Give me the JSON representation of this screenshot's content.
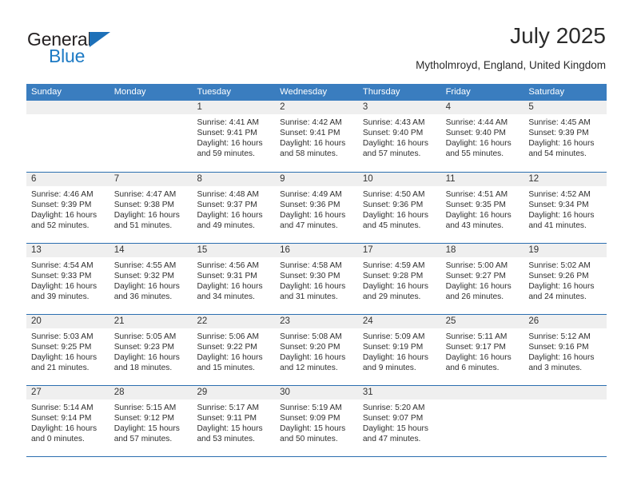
{
  "brand": {
    "name_part1": "General",
    "name_part2": "Blue",
    "accent_color": "#1d7ac4",
    "header_color": "#3a7dbf"
  },
  "header": {
    "title": "July 2025",
    "subtitle": "Mytholmroyd, England, United Kingdom"
  },
  "weekdays": [
    "Sunday",
    "Monday",
    "Tuesday",
    "Wednesday",
    "Thursday",
    "Friday",
    "Saturday"
  ],
  "weeks": [
    [
      {
        "day": "",
        "sunrise": "",
        "sunset": "",
        "daylight_1": "",
        "daylight_2": ""
      },
      {
        "day": "",
        "sunrise": "",
        "sunset": "",
        "daylight_1": "",
        "daylight_2": ""
      },
      {
        "day": "1",
        "sunrise": "Sunrise: 4:41 AM",
        "sunset": "Sunset: 9:41 PM",
        "daylight_1": "Daylight: 16 hours",
        "daylight_2": "and 59 minutes."
      },
      {
        "day": "2",
        "sunrise": "Sunrise: 4:42 AM",
        "sunset": "Sunset: 9:41 PM",
        "daylight_1": "Daylight: 16 hours",
        "daylight_2": "and 58 minutes."
      },
      {
        "day": "3",
        "sunrise": "Sunrise: 4:43 AM",
        "sunset": "Sunset: 9:40 PM",
        "daylight_1": "Daylight: 16 hours",
        "daylight_2": "and 57 minutes."
      },
      {
        "day": "4",
        "sunrise": "Sunrise: 4:44 AM",
        "sunset": "Sunset: 9:40 PM",
        "daylight_1": "Daylight: 16 hours",
        "daylight_2": "and 55 minutes."
      },
      {
        "day": "5",
        "sunrise": "Sunrise: 4:45 AM",
        "sunset": "Sunset: 9:39 PM",
        "daylight_1": "Daylight: 16 hours",
        "daylight_2": "and 54 minutes."
      }
    ],
    [
      {
        "day": "6",
        "sunrise": "Sunrise: 4:46 AM",
        "sunset": "Sunset: 9:39 PM",
        "daylight_1": "Daylight: 16 hours",
        "daylight_2": "and 52 minutes."
      },
      {
        "day": "7",
        "sunrise": "Sunrise: 4:47 AM",
        "sunset": "Sunset: 9:38 PM",
        "daylight_1": "Daylight: 16 hours",
        "daylight_2": "and 51 minutes."
      },
      {
        "day": "8",
        "sunrise": "Sunrise: 4:48 AM",
        "sunset": "Sunset: 9:37 PM",
        "daylight_1": "Daylight: 16 hours",
        "daylight_2": "and 49 minutes."
      },
      {
        "day": "9",
        "sunrise": "Sunrise: 4:49 AM",
        "sunset": "Sunset: 9:36 PM",
        "daylight_1": "Daylight: 16 hours",
        "daylight_2": "and 47 minutes."
      },
      {
        "day": "10",
        "sunrise": "Sunrise: 4:50 AM",
        "sunset": "Sunset: 9:36 PM",
        "daylight_1": "Daylight: 16 hours",
        "daylight_2": "and 45 minutes."
      },
      {
        "day": "11",
        "sunrise": "Sunrise: 4:51 AM",
        "sunset": "Sunset: 9:35 PM",
        "daylight_1": "Daylight: 16 hours",
        "daylight_2": "and 43 minutes."
      },
      {
        "day": "12",
        "sunrise": "Sunrise: 4:52 AM",
        "sunset": "Sunset: 9:34 PM",
        "daylight_1": "Daylight: 16 hours",
        "daylight_2": "and 41 minutes."
      }
    ],
    [
      {
        "day": "13",
        "sunrise": "Sunrise: 4:54 AM",
        "sunset": "Sunset: 9:33 PM",
        "daylight_1": "Daylight: 16 hours",
        "daylight_2": "and 39 minutes."
      },
      {
        "day": "14",
        "sunrise": "Sunrise: 4:55 AM",
        "sunset": "Sunset: 9:32 PM",
        "daylight_1": "Daylight: 16 hours",
        "daylight_2": "and 36 minutes."
      },
      {
        "day": "15",
        "sunrise": "Sunrise: 4:56 AM",
        "sunset": "Sunset: 9:31 PM",
        "daylight_1": "Daylight: 16 hours",
        "daylight_2": "and 34 minutes."
      },
      {
        "day": "16",
        "sunrise": "Sunrise: 4:58 AM",
        "sunset": "Sunset: 9:30 PM",
        "daylight_1": "Daylight: 16 hours",
        "daylight_2": "and 31 minutes."
      },
      {
        "day": "17",
        "sunrise": "Sunrise: 4:59 AM",
        "sunset": "Sunset: 9:28 PM",
        "daylight_1": "Daylight: 16 hours",
        "daylight_2": "and 29 minutes."
      },
      {
        "day": "18",
        "sunrise": "Sunrise: 5:00 AM",
        "sunset": "Sunset: 9:27 PM",
        "daylight_1": "Daylight: 16 hours",
        "daylight_2": "and 26 minutes."
      },
      {
        "day": "19",
        "sunrise": "Sunrise: 5:02 AM",
        "sunset": "Sunset: 9:26 PM",
        "daylight_1": "Daylight: 16 hours",
        "daylight_2": "and 24 minutes."
      }
    ],
    [
      {
        "day": "20",
        "sunrise": "Sunrise: 5:03 AM",
        "sunset": "Sunset: 9:25 PM",
        "daylight_1": "Daylight: 16 hours",
        "daylight_2": "and 21 minutes."
      },
      {
        "day": "21",
        "sunrise": "Sunrise: 5:05 AM",
        "sunset": "Sunset: 9:23 PM",
        "daylight_1": "Daylight: 16 hours",
        "daylight_2": "and 18 minutes."
      },
      {
        "day": "22",
        "sunrise": "Sunrise: 5:06 AM",
        "sunset": "Sunset: 9:22 PM",
        "daylight_1": "Daylight: 16 hours",
        "daylight_2": "and 15 minutes."
      },
      {
        "day": "23",
        "sunrise": "Sunrise: 5:08 AM",
        "sunset": "Sunset: 9:20 PM",
        "daylight_1": "Daylight: 16 hours",
        "daylight_2": "and 12 minutes."
      },
      {
        "day": "24",
        "sunrise": "Sunrise: 5:09 AM",
        "sunset": "Sunset: 9:19 PM",
        "daylight_1": "Daylight: 16 hours",
        "daylight_2": "and 9 minutes."
      },
      {
        "day": "25",
        "sunrise": "Sunrise: 5:11 AM",
        "sunset": "Sunset: 9:17 PM",
        "daylight_1": "Daylight: 16 hours",
        "daylight_2": "and 6 minutes."
      },
      {
        "day": "26",
        "sunrise": "Sunrise: 5:12 AM",
        "sunset": "Sunset: 9:16 PM",
        "daylight_1": "Daylight: 16 hours",
        "daylight_2": "and 3 minutes."
      }
    ],
    [
      {
        "day": "27",
        "sunrise": "Sunrise: 5:14 AM",
        "sunset": "Sunset: 9:14 PM",
        "daylight_1": "Daylight: 16 hours",
        "daylight_2": "and 0 minutes."
      },
      {
        "day": "28",
        "sunrise": "Sunrise: 5:15 AM",
        "sunset": "Sunset: 9:12 PM",
        "daylight_1": "Daylight: 15 hours",
        "daylight_2": "and 57 minutes."
      },
      {
        "day": "29",
        "sunrise": "Sunrise: 5:17 AM",
        "sunset": "Sunset: 9:11 PM",
        "daylight_1": "Daylight: 15 hours",
        "daylight_2": "and 53 minutes."
      },
      {
        "day": "30",
        "sunrise": "Sunrise: 5:19 AM",
        "sunset": "Sunset: 9:09 PM",
        "daylight_1": "Daylight: 15 hours",
        "daylight_2": "and 50 minutes."
      },
      {
        "day": "31",
        "sunrise": "Sunrise: 5:20 AM",
        "sunset": "Sunset: 9:07 PM",
        "daylight_1": "Daylight: 15 hours",
        "daylight_2": "and 47 minutes."
      },
      {
        "day": "",
        "sunrise": "",
        "sunset": "",
        "daylight_1": "",
        "daylight_2": ""
      },
      {
        "day": "",
        "sunrise": "",
        "sunset": "",
        "daylight_1": "",
        "daylight_2": ""
      }
    ]
  ]
}
